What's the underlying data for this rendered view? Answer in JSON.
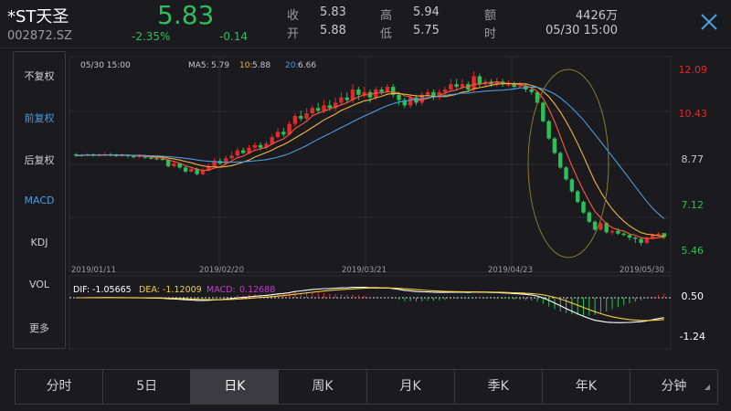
{
  "stock": {
    "name": "*ST天圣",
    "code": "002872.SZ",
    "price": "5.83",
    "change_pct": "-2.35%",
    "change": "-0.14"
  },
  "quote": {
    "close_label": "收",
    "close_val": "5.83",
    "open_label": "开",
    "open_val": "5.88",
    "high_label": "高",
    "high_val": "5.94",
    "low_label": "低",
    "low_val": "5.75",
    "amount_label": "额",
    "amount_val": "4426万",
    "time_label": "时",
    "time_val": "05/30 15:00"
  },
  "colors": {
    "up": "#e02b2b",
    "down": "#2dbf5a",
    "ma5": "#ff5a3c",
    "ma10": "#f2b33d",
    "ma20": "#4a9de0"
  },
  "sidebar": {
    "items": [
      {
        "label": "不复权"
      },
      {
        "label": "前复权"
      },
      {
        "label": "后复权"
      },
      {
        "label": "MACD"
      },
      {
        "label": "KDJ"
      },
      {
        "label": "VOL"
      },
      {
        "label": "更多"
      }
    ]
  },
  "legend": {
    "time": "05/30 15:00",
    "ma5_label": "MA5:",
    "ma5_val": "5.79",
    "ma10_label": "10:",
    "ma10_val": "5.88",
    "ma20_label": "20:",
    "ma20_val": "6.66"
  },
  "price_axis": [
    "12.09",
    "10.43",
    "8.77",
    "7.12",
    "5.46"
  ],
  "date_axis": [
    "2019/01/11",
    "2019/02/20",
    "2019/03/21",
    "2019/04/23",
    "2019/05/30"
  ],
  "macd": {
    "dif_label": "DIF:",
    "dif_val": "-1.05665",
    "dea_label": "DEA:",
    "dea_val": "-1.12009",
    "macd_label": "MACD:",
    "macd_val": "0.12688",
    "axis_top": "0.50",
    "axis_bottom": "-1.24"
  },
  "tabs": [
    {
      "label": "分时"
    },
    {
      "label": "5日"
    },
    {
      "label": "日K"
    },
    {
      "label": "周K"
    },
    {
      "label": "月K"
    },
    {
      "label": "季K"
    },
    {
      "label": "年K"
    },
    {
      "label": "分钟"
    }
  ],
  "chart_data": {
    "type": "candlestick",
    "price_range": [
      5.46,
      12.09
    ],
    "candles": [
      [
        8.95,
        8.9,
        9.0,
        8.85
      ],
      [
        8.9,
        8.92,
        8.98,
        8.85
      ],
      [
        8.92,
        8.95,
        9.0,
        8.88
      ],
      [
        8.95,
        8.9,
        8.98,
        8.86
      ],
      [
        8.9,
        8.93,
        8.98,
        8.86
      ],
      [
        8.93,
        8.95,
        9.02,
        8.88
      ],
      [
        8.95,
        8.92,
        9.0,
        8.87
      ],
      [
        8.92,
        8.9,
        8.96,
        8.85
      ],
      [
        8.9,
        8.92,
        8.98,
        8.86
      ],
      [
        8.92,
        8.88,
        8.95,
        8.82
      ],
      [
        8.88,
        8.85,
        8.92,
        8.8
      ],
      [
        8.85,
        8.9,
        8.95,
        8.8
      ],
      [
        8.9,
        8.82,
        8.93,
        8.78
      ],
      [
        8.82,
        8.8,
        8.88,
        8.75
      ],
      [
        8.8,
        8.78,
        8.85,
        8.72
      ],
      [
        8.78,
        8.75,
        8.82,
        8.7
      ],
      [
        8.75,
        8.5,
        8.78,
        8.45
      ],
      [
        8.5,
        8.6,
        8.7,
        8.45
      ],
      [
        8.6,
        8.45,
        8.62,
        8.4
      ],
      [
        8.45,
        8.3,
        8.5,
        8.25
      ],
      [
        8.3,
        8.4,
        8.5,
        8.25
      ],
      [
        8.4,
        8.2,
        8.45,
        8.15
      ],
      [
        8.2,
        8.35,
        8.45,
        8.15
      ],
      [
        8.35,
        8.5,
        8.6,
        8.3
      ],
      [
        8.5,
        8.7,
        8.8,
        8.45
      ],
      [
        8.7,
        8.6,
        8.8,
        8.55
      ],
      [
        8.6,
        8.8,
        8.9,
        8.55
      ],
      [
        8.8,
        8.9,
        9.05,
        8.75
      ],
      [
        8.9,
        9.1,
        9.2,
        8.85
      ],
      [
        9.1,
        9.0,
        9.2,
        8.95
      ],
      [
        9.0,
        9.2,
        9.3,
        8.95
      ],
      [
        9.2,
        9.3,
        9.4,
        9.1
      ],
      [
        9.3,
        9.2,
        9.4,
        9.1
      ],
      [
        9.2,
        9.35,
        9.45,
        9.15
      ],
      [
        9.35,
        9.6,
        9.7,
        9.3
      ],
      [
        9.6,
        9.8,
        9.95,
        9.55
      ],
      [
        9.8,
        9.7,
        9.95,
        9.6
      ],
      [
        9.7,
        10.1,
        10.2,
        9.65
      ],
      [
        10.1,
        10.4,
        10.5,
        10.0
      ],
      [
        10.4,
        10.3,
        10.6,
        10.2
      ],
      [
        10.3,
        10.5,
        10.7,
        10.2
      ],
      [
        10.5,
        10.7,
        10.8,
        10.4
      ],
      [
        10.7,
        10.6,
        10.9,
        10.5
      ],
      [
        10.6,
        10.8,
        11.0,
        10.5
      ],
      [
        10.8,
        10.7,
        11.0,
        10.6
      ],
      [
        10.7,
        10.9,
        11.1,
        10.6
      ],
      [
        10.9,
        11.1,
        11.3,
        10.8
      ],
      [
        11.1,
        11.0,
        11.3,
        10.9
      ],
      [
        11.0,
        11.4,
        11.6,
        10.9
      ],
      [
        11.4,
        11.2,
        11.5,
        11.0
      ],
      [
        11.2,
        11.3,
        11.5,
        11.1
      ],
      [
        11.3,
        11.1,
        11.4,
        10.9
      ],
      [
        11.1,
        11.4,
        11.5,
        11.0
      ],
      [
        11.4,
        11.3,
        11.5,
        11.2
      ],
      [
        11.3,
        11.5,
        11.6,
        11.2
      ],
      [
        11.5,
        11.2,
        11.6,
        11.1
      ],
      [
        11.2,
        11.0,
        11.3,
        10.8
      ],
      [
        11.0,
        10.8,
        11.1,
        10.7
      ],
      [
        10.8,
        11.1,
        11.2,
        10.7
      ],
      [
        11.1,
        10.9,
        11.2,
        10.8
      ],
      [
        10.9,
        11.2,
        11.3,
        10.8
      ],
      [
        11.2,
        11.3,
        11.4,
        11.1
      ],
      [
        11.3,
        11.1,
        11.4,
        11.0
      ],
      [
        11.1,
        11.3,
        11.4,
        11.0
      ],
      [
        11.3,
        11.4,
        11.5,
        11.2
      ],
      [
        11.4,
        11.6,
        11.8,
        11.3
      ],
      [
        11.6,
        11.5,
        11.8,
        11.4
      ],
      [
        11.5,
        11.6,
        11.8,
        11.4
      ],
      [
        11.6,
        11.4,
        11.7,
        11.3
      ],
      [
        11.4,
        11.9,
        12.09,
        11.3
      ],
      [
        11.9,
        11.6,
        12.0,
        11.5
      ],
      [
        11.6,
        11.7,
        11.8,
        11.5
      ],
      [
        11.7,
        11.6,
        11.8,
        11.5
      ],
      [
        11.6,
        11.7,
        11.85,
        11.5
      ],
      [
        11.7,
        11.6,
        11.8,
        11.5
      ],
      [
        11.6,
        11.6,
        11.75,
        11.5
      ],
      [
        11.6,
        11.5,
        11.7,
        11.4
      ],
      [
        11.5,
        11.55,
        11.7,
        11.45
      ],
      [
        11.55,
        11.4,
        11.6,
        11.3
      ],
      [
        11.4,
        11.3,
        11.5,
        11.2
      ],
      [
        11.3,
        10.9,
        11.35,
        10.85
      ],
      [
        10.9,
        10.2,
        10.95,
        10.15
      ],
      [
        10.2,
        9.55,
        10.25,
        9.5
      ],
      [
        9.55,
        9.0,
        9.6,
        8.95
      ],
      [
        9.0,
        8.45,
        9.05,
        8.4
      ],
      [
        8.45,
        8.0,
        8.5,
        7.95
      ],
      [
        8.0,
        7.55,
        8.05,
        7.5
      ],
      [
        7.55,
        7.15,
        7.6,
        7.1
      ],
      [
        7.15,
        6.75,
        7.2,
        6.7
      ],
      [
        6.75,
        6.4,
        6.8,
        6.35
      ],
      [
        6.4,
        6.1,
        6.45,
        6.05
      ],
      [
        6.1,
        6.35,
        6.4,
        6.05
      ],
      [
        6.35,
        6.0,
        6.4,
        5.95
      ],
      [
        6.0,
        6.05,
        6.1,
        5.9
      ],
      [
        6.05,
        5.95,
        6.15,
        5.9
      ],
      [
        5.95,
        5.9,
        6.0,
        5.85
      ],
      [
        5.9,
        5.8,
        5.95,
        5.7
      ],
      [
        5.8,
        5.75,
        5.85,
        5.6
      ],
      [
        5.75,
        5.6,
        5.8,
        5.5
      ],
      [
        5.6,
        5.78,
        5.85,
        5.55
      ],
      [
        5.78,
        5.9,
        5.95,
        5.75
      ],
      [
        5.9,
        5.95,
        6.0,
        5.85
      ],
      [
        5.97,
        5.83,
        5.94,
        5.75
      ]
    ]
  }
}
